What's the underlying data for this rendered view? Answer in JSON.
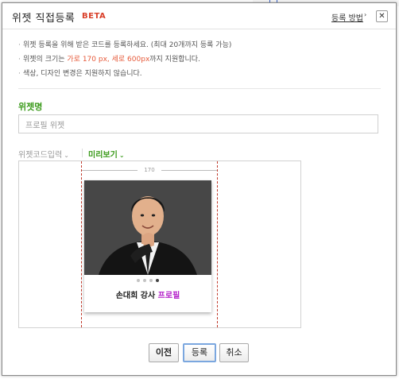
{
  "dialog": {
    "title": "위젯 직접등록",
    "badge": "BETA",
    "help_link": "등록 방법",
    "help_arrow": "›",
    "close_glyph": "✕"
  },
  "notes": [
    {
      "text": "위젯 등록을 위해 받은 코드를 등록하세요. (최대 20개까지 등록 가능)"
    },
    {
      "pre": "위젯의 크기는 ",
      "em1": "가로 170 px, 세로 600px",
      "post": "까지 지원합니다."
    },
    {
      "text": "색상, 디자인 변경은 지원하지 않습니다."
    }
  ],
  "name_field": {
    "label": "위젯명",
    "value": "프로필 위젯"
  },
  "tabs": {
    "code": "위젯코드입력",
    "preview": "미리보기",
    "chevron": "⌄",
    "active": "preview"
  },
  "preview": {
    "width_label": "170",
    "caption_name": "손대희 강사 ",
    "caption_highlight": "프로필",
    "dots_total": 4,
    "dots_active_index": 3
  },
  "buttons": {
    "prev": "이전",
    "ok": "등록",
    "cancel": "취소"
  },
  "colors": {
    "accent_green": "#3a9a1a",
    "beta_red": "#d9402a",
    "note_highlight": "#e65a3a",
    "caption_highlight": "#b31ec9",
    "guide_line": "#c0392b"
  }
}
